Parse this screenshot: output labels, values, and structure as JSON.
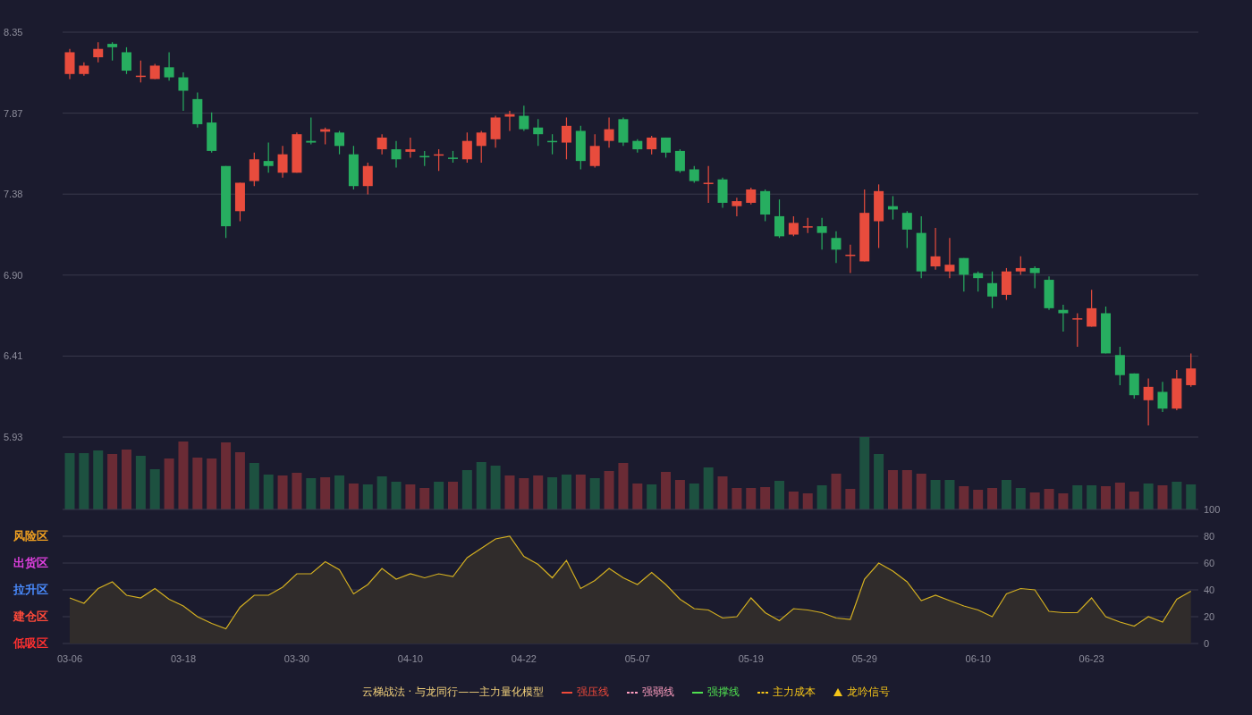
{
  "price_chart": {
    "chart_data": {
      "type": "candlestick",
      "ylim": [
        5.93,
        8.35
      ],
      "grid": true,
      "yticks": [
        {
          "value": 8.35,
          "label": "8.35"
        },
        {
          "value": 7.866,
          "label": "7.87"
        },
        {
          "value": 7.382,
          "label": "7.38"
        },
        {
          "value": 6.898,
          "label": "6.90"
        },
        {
          "value": 6.414,
          "label": "6.41"
        },
        {
          "value": 5.93,
          "label": "5.93"
        }
      ],
      "categories": [
        null,
        null,
        null,
        null,
        null,
        null,
        null,
        null,
        null,
        null,
        null,
        null,
        null,
        null,
        null,
        null,
        null,
        null,
        null,
        null,
        null,
        null,
        null,
        null,
        null,
        null,
        null,
        null,
        null,
        null,
        null,
        null,
        null,
        null,
        null,
        null,
        null,
        null,
        null,
        null,
        null,
        null,
        null,
        null,
        null,
        null,
        null,
        null,
        null,
        null,
        null,
        null,
        null,
        null,
        null,
        null,
        null,
        null,
        null,
        null,
        null,
        null,
        null,
        null,
        null,
        null,
        null,
        null,
        null,
        null,
        null,
        null,
        null,
        null,
        null,
        null,
        null,
        null,
        null,
        null
      ],
      "ohlc": [
        [
          8.1,
          8.25,
          8.07,
          8.23
        ],
        [
          8.1,
          8.17,
          8.09,
          8.15
        ],
        [
          8.2,
          8.29,
          8.17,
          8.25
        ],
        [
          8.28,
          8.29,
          8.18,
          8.26
        ],
        [
          8.23,
          8.26,
          8.1,
          8.12
        ],
        [
          8.085,
          8.18,
          8.05,
          8.09
        ],
        [
          8.07,
          8.16,
          8.07,
          8.15
        ],
        [
          8.14,
          8.23,
          8.06,
          8.08
        ],
        [
          8.08,
          8.11,
          7.88,
          8.0
        ],
        [
          7.95,
          7.99,
          7.78,
          7.8
        ],
        [
          7.81,
          7.87,
          7.63,
          7.64
        ],
        [
          7.55,
          7.55,
          7.12,
          7.19
        ],
        [
          7.28,
          7.45,
          7.22,
          7.45
        ],
        [
          7.46,
          7.63,
          7.43,
          7.59
        ],
        [
          7.58,
          7.69,
          7.51,
          7.55
        ],
        [
          7.51,
          7.67,
          7.48,
          7.62
        ],
        [
          7.51,
          7.75,
          7.51,
          7.74
        ],
        [
          7.7,
          7.84,
          7.68,
          7.69
        ],
        [
          7.755,
          7.78,
          7.68,
          7.77
        ],
        [
          7.75,
          7.76,
          7.62,
          7.67
        ],
        [
          7.62,
          7.67,
          7.41,
          7.43
        ],
        [
          7.43,
          7.57,
          7.38,
          7.55
        ],
        [
          7.65,
          7.74,
          7.62,
          7.72
        ],
        [
          7.65,
          7.7,
          7.54,
          7.59
        ],
        [
          7.635,
          7.72,
          7.6,
          7.65
        ],
        [
          7.61,
          7.64,
          7.55,
          7.605
        ],
        [
          7.615,
          7.65,
          7.52,
          7.62
        ],
        [
          7.6,
          7.64,
          7.57,
          7.595
        ],
        [
          7.59,
          7.75,
          7.57,
          7.7
        ],
        [
          7.67,
          7.76,
          7.57,
          7.75
        ],
        [
          7.71,
          7.85,
          7.66,
          7.84
        ],
        [
          7.845,
          7.88,
          7.76,
          7.86
        ],
        [
          7.85,
          7.91,
          7.76,
          7.77
        ],
        [
          7.78,
          7.83,
          7.67,
          7.74
        ],
        [
          7.7,
          7.74,
          7.62,
          7.695
        ],
        [
          7.69,
          7.84,
          7.59,
          7.79
        ],
        [
          7.76,
          7.79,
          7.53,
          7.58
        ],
        [
          7.55,
          7.74,
          7.54,
          7.67
        ],
        [
          7.7,
          7.84,
          7.66,
          7.77
        ],
        [
          7.83,
          7.84,
          7.67,
          7.69
        ],
        [
          7.7,
          7.71,
          7.63,
          7.65
        ],
        [
          7.65,
          7.73,
          7.62,
          7.72
        ],
        [
          7.72,
          7.72,
          7.6,
          7.63
        ],
        [
          7.64,
          7.65,
          7.51,
          7.52
        ],
        [
          7.53,
          7.55,
          7.45,
          7.46
        ],
        [
          7.445,
          7.55,
          7.33,
          7.45
        ],
        [
          7.47,
          7.48,
          7.3,
          7.33
        ],
        [
          7.31,
          7.36,
          7.25,
          7.34
        ],
        [
          7.33,
          7.42,
          7.32,
          7.41
        ],
        [
          7.4,
          7.41,
          7.22,
          7.26
        ],
        [
          7.25,
          7.35,
          7.12,
          7.13
        ],
        [
          7.14,
          7.25,
          7.13,
          7.21
        ],
        [
          7.185,
          7.24,
          7.15,
          7.19
        ],
        [
          7.19,
          7.24,
          7.05,
          7.15
        ],
        [
          7.12,
          7.16,
          6.97,
          7.05
        ],
        [
          7.015,
          7.08,
          6.91,
          7.02
        ],
        [
          6.98,
          7.41,
          6.98,
          7.27
        ],
        [
          7.22,
          7.44,
          7.06,
          7.4
        ],
        [
          7.31,
          7.37,
          7.23,
          7.29
        ],
        [
          7.27,
          7.28,
          7.06,
          7.17
        ],
        [
          7.15,
          7.25,
          6.88,
          6.92
        ],
        [
          6.95,
          7.18,
          6.93,
          7.01
        ],
        [
          6.92,
          7.12,
          6.88,
          6.96
        ],
        [
          7.0,
          7.0,
          6.8,
          6.9
        ],
        [
          6.91,
          6.92,
          6.8,
          6.88
        ],
        [
          6.85,
          6.92,
          6.7,
          6.77
        ],
        [
          6.78,
          6.94,
          6.75,
          6.92
        ],
        [
          6.92,
          7.01,
          6.9,
          6.94
        ],
        [
          6.94,
          6.95,
          6.82,
          6.91
        ],
        [
          6.87,
          6.89,
          6.69,
          6.7
        ],
        [
          6.69,
          6.72,
          6.56,
          6.67
        ],
        [
          6.635,
          6.67,
          6.47,
          6.64
        ],
        [
          6.59,
          6.81,
          6.59,
          6.7
        ],
        [
          6.67,
          6.71,
          6.43,
          6.43
        ],
        [
          6.42,
          6.47,
          6.24,
          6.3
        ],
        [
          6.31,
          6.31,
          6.16,
          6.18
        ],
        [
          6.15,
          6.28,
          6.0,
          6.23
        ],
        [
          6.2,
          6.26,
          6.08,
          6.1
        ],
        [
          6.1,
          6.33,
          6.09,
          6.28
        ],
        [
          6.24,
          6.43,
          6.23,
          6.34
        ]
      ]
    }
  },
  "indicator_chart": {
    "zones": [
      {
        "label": "风险区",
        "color": "#f0a020"
      },
      {
        "label": "出货区",
        "color": "#e040e0"
      },
      {
        "label": "拉升区",
        "color": "#4a8cff"
      },
      {
        "label": "建仓区",
        "color": "#ff4a3a"
      },
      {
        "label": "低吸区",
        "color": "#ff3030"
      }
    ],
    "chart_data": {
      "type": "area",
      "ylim": [
        0,
        100
      ],
      "yticks": [
        0,
        20,
        40,
        60,
        80,
        100
      ],
      "grid": true,
      "categories": [
        "03-06",
        null,
        null,
        null,
        null,
        null,
        null,
        null,
        "03-18",
        null,
        null,
        null,
        null,
        null,
        null,
        null,
        "03-30",
        null,
        null,
        null,
        null,
        null,
        null,
        null,
        "04-10",
        null,
        null,
        null,
        null,
        null,
        null,
        null,
        "04-22",
        null,
        null,
        null,
        null,
        null,
        null,
        null,
        "05-07",
        null,
        null,
        null,
        null,
        null,
        null,
        null,
        "05-19",
        null,
        null,
        null,
        null,
        null,
        null,
        null,
        "05-29",
        null,
        null,
        null,
        null,
        null,
        null,
        null,
        "06-10",
        null,
        null,
        null,
        null,
        null,
        null,
        null,
        "06-23",
        null,
        null,
        null,
        null,
        null,
        null,
        null
      ],
      "series": [
        {
          "color": "#d4b021",
          "values": [
            34,
            30,
            41,
            46,
            36,
            34,
            41,
            33,
            28,
            20,
            15,
            11,
            27,
            36,
            36,
            42,
            52,
            52,
            61,
            55,
            37,
            44,
            56,
            48,
            52,
            49,
            52,
            50,
            64,
            71,
            78,
            80,
            65,
            59,
            49,
            62,
            41,
            47,
            56,
            49,
            44,
            53,
            44,
            33,
            26,
            25,
            19,
            20,
            34,
            23,
            17,
            26,
            25,
            23,
            19,
            18,
            48,
            60,
            54,
            46,
            32,
            36,
            32,
            28,
            25,
            20,
            37,
            41,
            40,
            24,
            23,
            23,
            34,
            20,
            16,
            13,
            20,
            16,
            33,
            39
          ]
        }
      ]
    }
  },
  "legend": {
    "title": "云梯战法 · 与龙同行——主力量化模型",
    "items": [
      {
        "label": "强压线",
        "kind": "line",
        "color": "#f04a3a"
      },
      {
        "label": "强弱线",
        "kind": "dashed",
        "color": "#ff9ec0"
      },
      {
        "label": "强撑线",
        "kind": "line",
        "color": "#50e050"
      },
      {
        "label": "主力成本",
        "kind": "dashed",
        "color": "#f5c518"
      },
      {
        "label": "龙吟信号",
        "kind": "triangle",
        "color": "#f5c518"
      }
    ]
  }
}
